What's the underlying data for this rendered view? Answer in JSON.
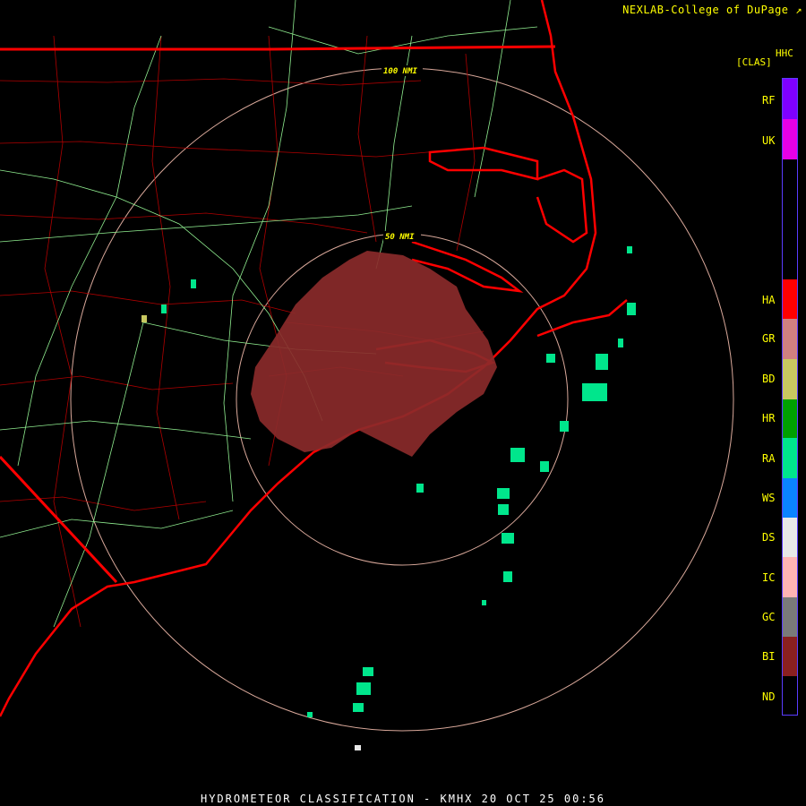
{
  "credit": "NEXLAB-College of DuPage",
  "product_code": "HHC",
  "product_label": "[CLAS]",
  "footer": "HYDROMETEOR CLASSIFICATION - KMHX 20 OCT 25 00:56",
  "range_rings": [
    {
      "label": "100 NMI",
      "range_nmi": 100
    },
    {
      "label": "50 NMI",
      "range_nmi": 50
    }
  ],
  "legend": [
    {
      "code": "RF",
      "color": "#7f00ff"
    },
    {
      "code": "UK",
      "color": "#e600e6"
    },
    {
      "code": "HA",
      "color": "#ff0000"
    },
    {
      "code": "GR",
      "color": "#d08080"
    },
    {
      "code": "BD",
      "color": "#c8c860"
    },
    {
      "code": "HR",
      "color": "#00a000"
    },
    {
      "code": "RA",
      "color": "#00e68c"
    },
    {
      "code": "WS",
      "color": "#0a84ff"
    },
    {
      "code": "DS",
      "color": "#e8e8e8"
    },
    {
      "code": "IC",
      "color": "#ffb4b4"
    },
    {
      "code": "GC",
      "color": "#7a7a7a"
    },
    {
      "code": "BI",
      "color": "#8a2020"
    },
    {
      "code": "ND",
      "color": "#000000"
    }
  ],
  "colors": {
    "coast": "#ff0000",
    "county": "#cc0000",
    "roads": "#90ee90",
    "ring": "#d9a89a"
  }
}
